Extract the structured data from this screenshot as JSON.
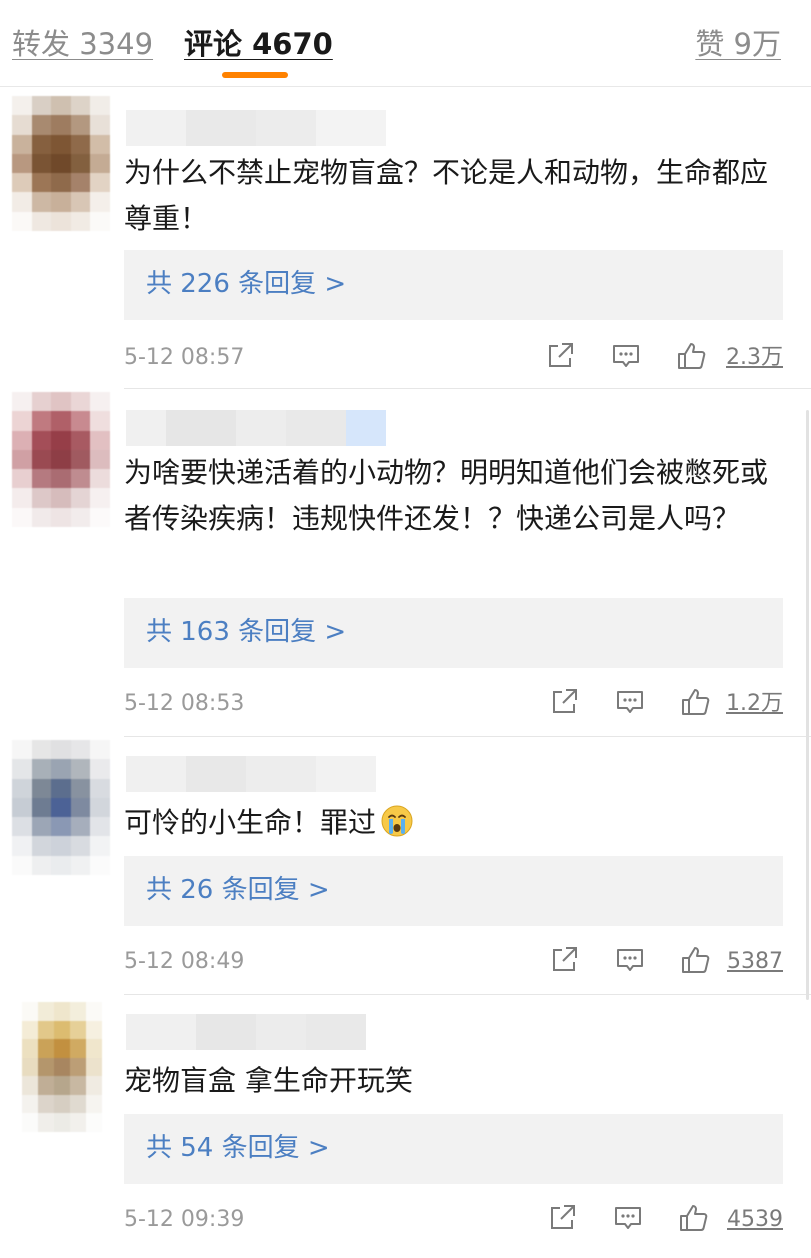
{
  "tabs": {
    "repost": "转发 3349",
    "comment": "评论 4670",
    "likes": "赞 9万",
    "accent_color": "#ff8200"
  },
  "icons": {
    "share": "share-icon",
    "comment": "comment-icon",
    "like": "thumbs-up-icon",
    "crying": "crying-face-emoji"
  },
  "comments": [
    {
      "text": "为什么不禁止宠物盲盒？不论是人和动物，生命都应尊重！",
      "replies": "共 226 条回复 >",
      "time": "5-12 08:57",
      "likes": "2.3万"
    },
    {
      "text": "为啥要快递活着的小动物？明明知道他们会被憋死或者传染疾病！违规快件还发！？快递公司是人吗？",
      "replies": "共 163 条回复 >",
      "time": "5-12 08:53",
      "likes": "1.2万"
    },
    {
      "text": "可怜的小生命！罪过",
      "replies": "共 26 条回复 >",
      "time": "5-12 08:49",
      "likes": "5387"
    },
    {
      "text": "宠物盲盒 拿生命开玩笑",
      "replies": "共 54 条回复 >",
      "time": "5-12 09:39",
      "likes": "4539"
    }
  ]
}
